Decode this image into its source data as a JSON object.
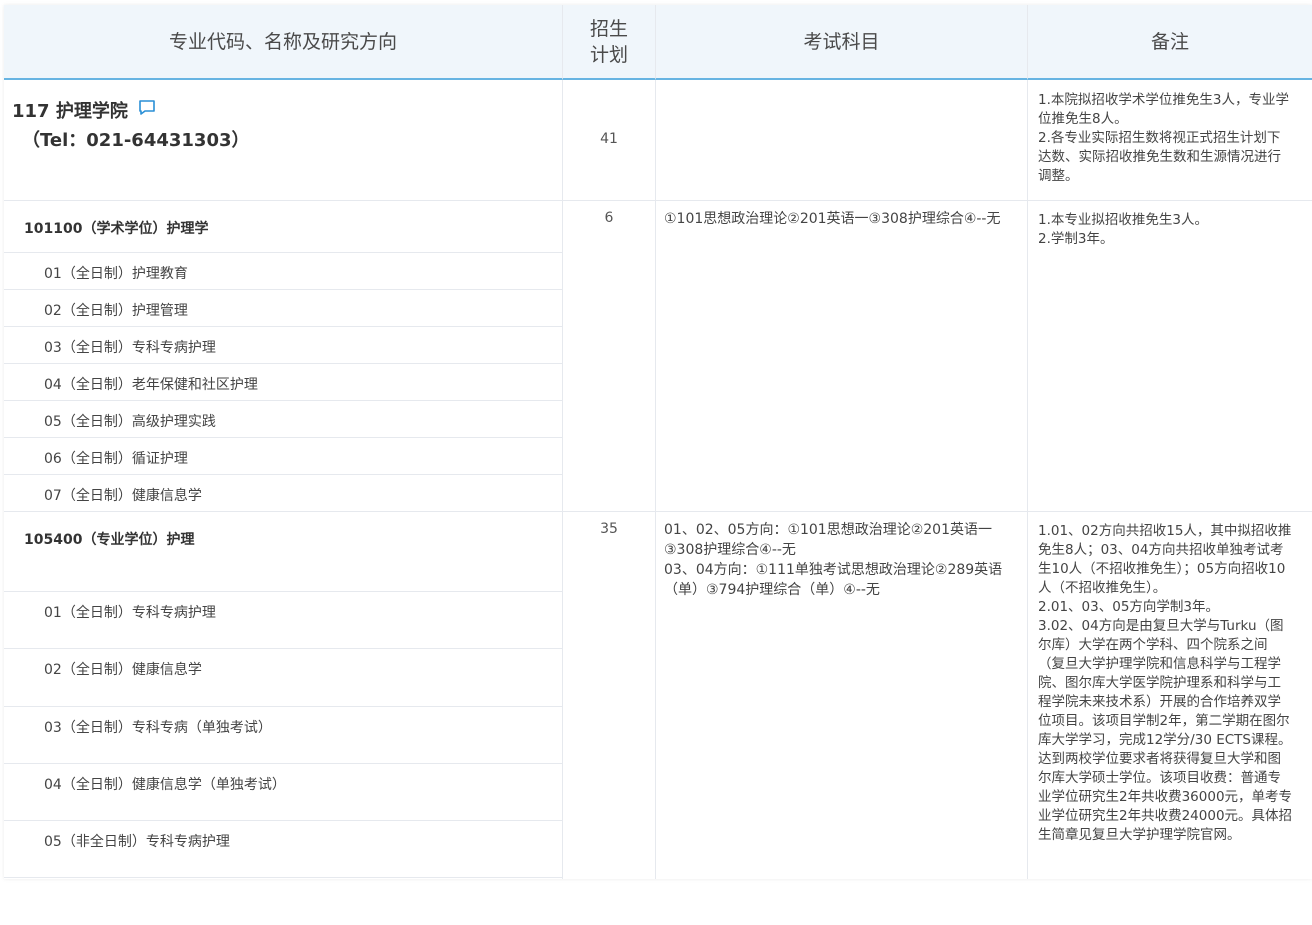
{
  "header": {
    "col1": "专业代码、名称及研究方向",
    "col2_line1": "招生",
    "col2_line2": "计划",
    "col3": "考试科目",
    "col4": "备注"
  },
  "dept": {
    "name": "117 护理学院",
    "tel": "（Tel：021-64431303）",
    "plan": "41",
    "notes": [
      "1.本院拟招收学术学位推免生3人，专业学",
      "位推免生8人。",
      "2.各专业实际招生数将视正式招生计划下",
      "达数、实际招收推免生数和生源情况进行",
      "调整。"
    ]
  },
  "major1": {
    "title": "101100（学术学位）护理学",
    "plan": "6",
    "subjects": "①101思想政治理论②201英语一③308护理综合④--无",
    "notes": [
      "1.本专业拟招收推免生3人。",
      "2.学制3年。"
    ],
    "directions": [
      "01（全日制）护理教育",
      "02（全日制）护理管理",
      "03（全日制）专科专病护理",
      "04（全日制）老年保健和社区护理",
      "05（全日制）高级护理实践",
      "06（全日制）循证护理",
      "07（全日制）健康信息学"
    ]
  },
  "major2": {
    "title": "105400（专业学位）护理",
    "plan": "35",
    "subjects": [
      "01、02、05方向：①101思想政治理论②201英语一",
      "③308护理综合④--无",
      "03、04方向：①111单独考试思想政治理论②289英语",
      "（单）③794护理综合（单）④--无"
    ],
    "notes": [
      "1.01、02方向共招收15人，其中拟招收推",
      "免生8人；03、04方向共招收单独考试考",
      "生10人（不招收推免生）；05方向招收10",
      "人（不招收推免生）。",
      "2.01、03、05方向学制3年。",
      "3.02、04方向是由复旦大学与Turku（图",
      "尔库）大学在两个学科、四个院系之间",
      "（复旦大学护理学院和信息科学与工程学",
      "院、图尔库大学医学院护理系和科学与工",
      "程学院未来技术系）开展的合作培养双学",
      "位项目。该项目学制2年，第二学期在图尔",
      "库大学学习，完成12学分/30 ECTS课程。",
      "达到两校学位要求者将获得复旦大学和图",
      "尔库大学硕士学位。该项目收费：普通专",
      "业学位研究生2年共收费36000元，单考专",
      "业学位研究生2年共收费24000元。具体招",
      "生简章见复旦大学护理学院官网。"
    ],
    "directions": [
      "01（全日制）专科专病护理",
      "02（全日制）健康信息学",
      "03（全日制）专科专病（单独考试）",
      "04（全日制）健康信息学（单独考试）",
      "05（非全日制）专科专病护理"
    ]
  },
  "colors": {
    "header_bg": "#f0f6fb",
    "header_border": "#67b4e2",
    "icon": "#2a8fd6"
  }
}
